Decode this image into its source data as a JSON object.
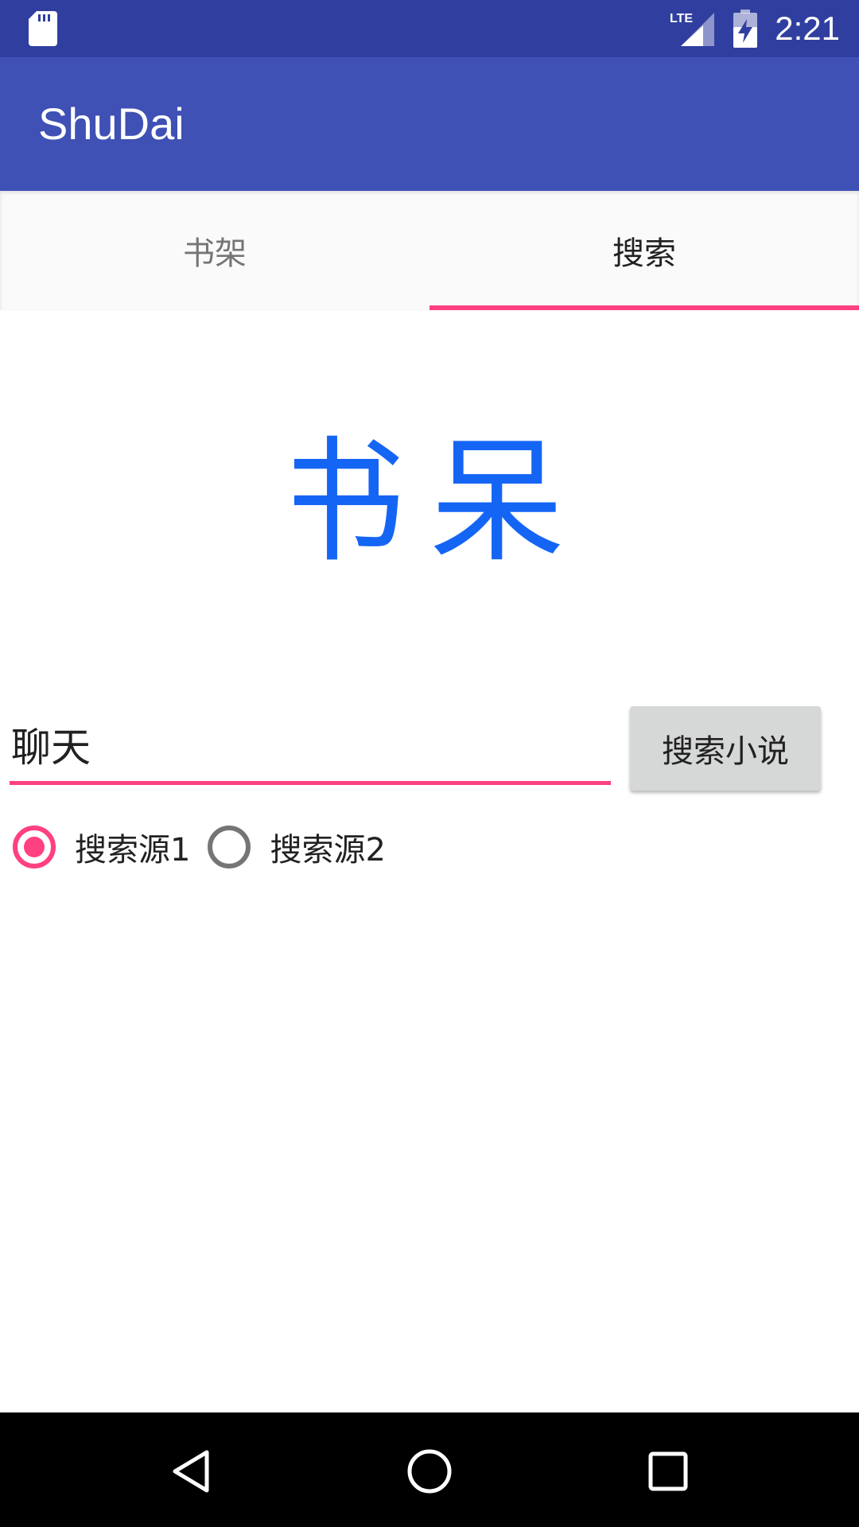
{
  "status_bar": {
    "time": "2:21",
    "network_label": "LTE",
    "icons": [
      "sd-card-icon",
      "lte-signal-icon",
      "battery-charging-icon"
    ]
  },
  "app_bar": {
    "title": "ShuDai"
  },
  "tabs": [
    {
      "label": "书架",
      "selected": false
    },
    {
      "label": "搜索",
      "selected": true
    }
  ],
  "logo": {
    "text": "书呆",
    "color": "#1565F5"
  },
  "search": {
    "value": "聊天",
    "button_label": "搜索小说"
  },
  "sources": [
    {
      "label": "搜索源1",
      "checked": true
    },
    {
      "label": "搜索源2",
      "checked": false
    }
  ],
  "nav_bar": {
    "icons": [
      "back-icon",
      "home-icon",
      "recents-icon"
    ]
  },
  "colors": {
    "status_bar": "#303F9F",
    "primary": "#3F51B5",
    "accent": "#FF4081",
    "tab_bg": "#FAFAFA",
    "button_bg": "#D6D7D7"
  }
}
